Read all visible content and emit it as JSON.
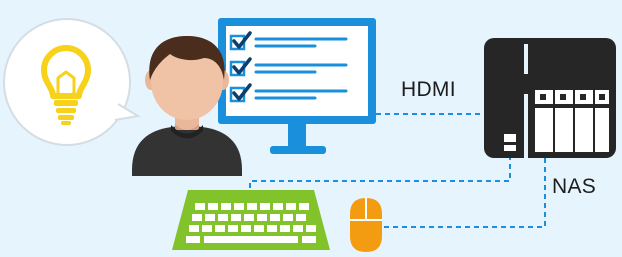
{
  "diagram": {
    "labels": {
      "hdmi": "HDMI",
      "nas": "NAS"
    },
    "nodes": [
      {
        "id": "idea-bubble",
        "icon": "lightbulb-icon"
      },
      {
        "id": "user",
        "icon": "person-avatar-icon"
      },
      {
        "id": "monitor",
        "icon": "monitor-checklist-icon"
      },
      {
        "id": "nas",
        "icon": "nas-device-icon"
      },
      {
        "id": "keyboard",
        "icon": "keyboard-icon"
      },
      {
        "id": "mouse",
        "icon": "mouse-icon"
      }
    ],
    "connections": [
      {
        "from": "monitor",
        "to": "nas",
        "label": "HDMI",
        "style": "dashed"
      },
      {
        "from": "keyboard",
        "to": "nas",
        "style": "dashed"
      },
      {
        "from": "mouse",
        "to": "nas",
        "style": "dashed"
      }
    ],
    "colors": {
      "background": "#e6f4fd",
      "monitor_blue": "#1a8fdc",
      "connector_blue": "#1a8fdc",
      "nas_dark": "#262626",
      "keyboard_green": "#82c22a",
      "mouse_orange": "#f39c12",
      "bulb_yellow": "#f6d21a",
      "bubble_white": "#ffffff"
    }
  }
}
